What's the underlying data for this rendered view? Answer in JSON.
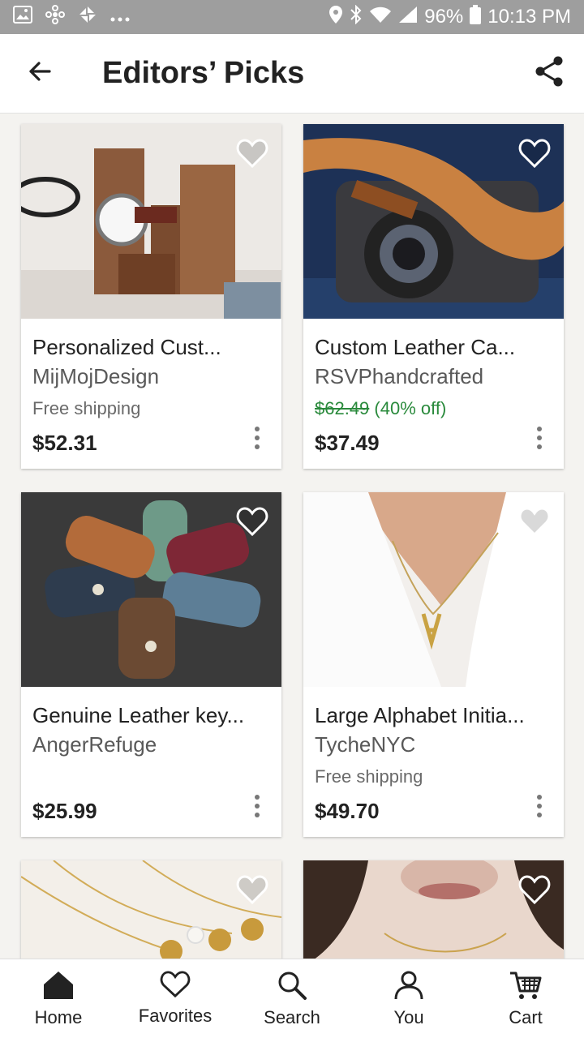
{
  "status_bar": {
    "battery": "96%",
    "time": "10:13 PM",
    "left_icons": [
      "gallery-icon",
      "pinwheel-icon",
      "sync-icon",
      "more-dots-icon"
    ],
    "right_icons": [
      "location-icon",
      "bluetooth-icon",
      "wifi-icon",
      "signal-icon",
      "battery-icon"
    ]
  },
  "app_bar": {
    "title": "Editors’ Picks",
    "back_icon": "arrow-left-icon",
    "share_icon": "share-icon"
  },
  "listings": [
    {
      "title": "Personalized Cust...",
      "shop": "MijMojDesign",
      "shipping": "Free shipping",
      "price": "$52.31"
    },
    {
      "title": "Custom Leather Ca...",
      "shop": "RSVPhandcrafted",
      "original_price": "$62.49",
      "discount": "(40% off)",
      "price": "$37.49"
    },
    {
      "title": "Genuine Leather key...",
      "shop": "AngerRefuge",
      "price": "$25.99"
    },
    {
      "title": "Large Alphabet Initia...",
      "shop": "TycheNYC",
      "shipping": "Free shipping",
      "price": "$49.70"
    }
  ],
  "bottom_nav": {
    "items": [
      {
        "label": "Home",
        "icon": "home-icon",
        "active": true
      },
      {
        "label": "Favorites",
        "icon": "heart-icon"
      },
      {
        "label": "Search",
        "icon": "search-icon"
      },
      {
        "label": "You",
        "icon": "person-icon"
      },
      {
        "label": "Cart",
        "icon": "cart-icon"
      }
    ]
  },
  "colors": {
    "accent_green": "#2a8a3c",
    "status_bar": "#9e9e9e",
    "background": "#f4f3f0"
  }
}
